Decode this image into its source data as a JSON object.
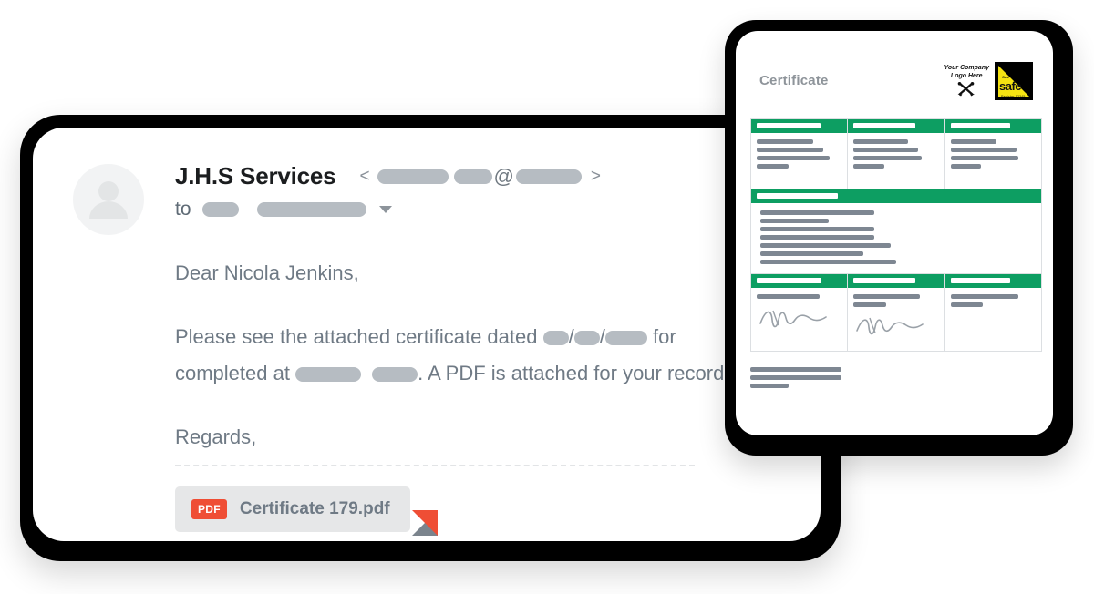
{
  "email": {
    "sender_name": "J.H.S Services",
    "address": {
      "open_bracket": "<",
      "close_bracket": ">",
      "at_symbol": "@",
      "redacted_local_1_width": 78,
      "redacted_local_2_width": 42,
      "redacted_domain_width": 72
    },
    "to_label": "to",
    "to_redacted_1_width": 40,
    "to_redacted_2_width": 120,
    "greeting": "Dear Nicola Jenkins,",
    "body_line_1_prefix": "Please see the attached certificate dated ",
    "body_line_1_suffix": " for",
    "body_line_2_prefix": "completed at ",
    "body_line_2_suffix": ". A PDF is attached for your records.",
    "date_sep": "/",
    "signoff": "Regards,",
    "attachment": {
      "type_badge": "PDF",
      "filename": "Certificate 179.pdf"
    }
  },
  "certificate": {
    "title": "Certificate",
    "logo_text_line_1": "Your Company",
    "logo_text_line_2": "Logo Here",
    "safe_logo": {
      "word": "safe",
      "top_text": "Gas",
      "sub_text": "Register 12345"
    },
    "top_row": {
      "columns": [
        {
          "header_width": "75%",
          "lines": [
            "66%",
            "78%",
            "86%",
            "38%"
          ]
        },
        {
          "header_width": "72%",
          "lines": [
            "64%",
            "76%",
            "80%",
            "36%"
          ]
        },
        {
          "header_width": "70%",
          "lines": [
            "54%",
            "78%",
            "80%",
            "36%"
          ]
        }
      ]
    },
    "band_section": {
      "header_width": "29%",
      "lines": [
        "42%",
        "25%",
        "42%",
        "42%",
        "48%",
        "38%",
        "50%"
      ]
    },
    "signature_row": {
      "columns": [
        {
          "header_width": "76%",
          "lines": [
            "74%"
          ],
          "has_signature": true
        },
        {
          "header_width": "72%",
          "lines": [
            "78%",
            "38%"
          ],
          "has_signature": true
        },
        {
          "header_width": "70%",
          "lines": [
            "80%",
            "38%"
          ],
          "has_signature": false
        }
      ]
    },
    "footer_lines": [
      "100%",
      "100%",
      "42%"
    ]
  },
  "colors": {
    "green": "#0d9e62",
    "pdf_red": "#ef4e35",
    "text_grey": "#6f7a85",
    "bar_grey": "#7e8792",
    "pill_grey": "#b6bcc2",
    "card_border": "#000000",
    "logo_yellow": "#f5e312"
  }
}
